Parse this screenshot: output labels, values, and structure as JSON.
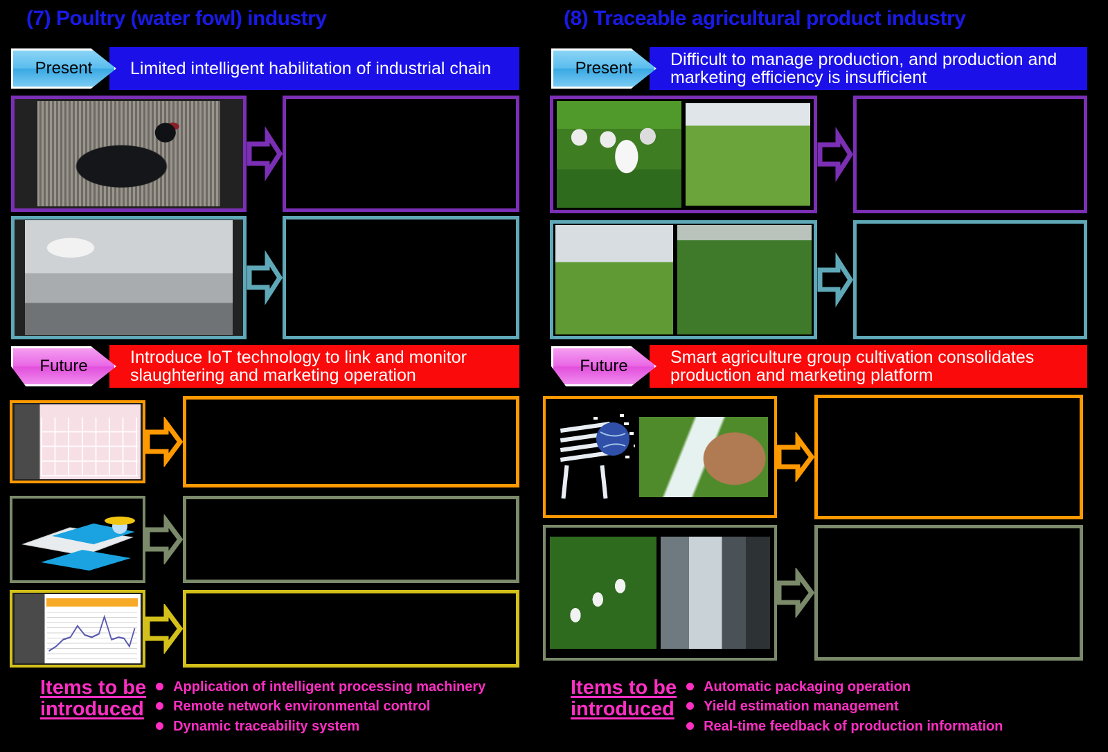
{
  "left": {
    "section_title": "(7) Poultry (water fowl) industry",
    "present": {
      "tag": "Present",
      "text": "Limited intelligent habilitation of industrial chain"
    },
    "future": {
      "tag": "Future",
      "text": "Introduce IoT technology to link and monitor slaughtering and marketing operation"
    },
    "present_rows": [
      {
        "image_name": "black-water-fowl-in-cage-photo",
        "border_color": "#7b2fb5",
        "text": ""
      },
      {
        "image_name": "poultry-slaughter-line-worker-photo",
        "border_color": "#5fa8b8",
        "text": ""
      }
    ],
    "future_rows": [
      {
        "image_name": "poultry-management-web-system-screenshot",
        "border_color": "#ff9900",
        "text": ""
      },
      {
        "image_name": "cloud-platform-farmer-illustration",
        "border_color": "#7b8a6a",
        "text": ""
      },
      {
        "image_name": "production-trend-chart-screenshot",
        "border_color": "#d4c01a",
        "text": ""
      }
    ],
    "items": {
      "label_line1": "Items to be",
      "label_line2": "introduced",
      "bullets": [
        "Application of intelligent processing machinery",
        "Remote network environmental control",
        "Dynamic traceability system"
      ]
    }
  },
  "right": {
    "section_title": "(8) Traceable agricultural product industry",
    "present": {
      "tag": "Present",
      "text": "Difficult to manage production, and production and marketing efficiency is insufficient"
    },
    "future": {
      "tag": "Future",
      "text": "Smart agriculture group cultivation consolidates production and marketing platform"
    },
    "present_rows": [
      {
        "image_name": "vegetable-farmers-group-photo",
        "image_name_2": "vegetable-field-rows-photo",
        "border_color": "#7b2fb5",
        "text": ""
      },
      {
        "image_name": "harvest-loading-truck-photo",
        "image_name_2": "field-harvesting-workers-photo",
        "border_color": "#5fa8b8",
        "text": ""
      }
    ],
    "future_rows": [
      {
        "image_name": "iot-cloud-globe-illustration",
        "image_name_2": "hand-holding-smartphone-in-field-photo",
        "border_color": "#ff9900",
        "text": ""
      },
      {
        "image_name": "dairy-cattle-grazing-photo",
        "image_name_2": "packing-facility-interior-photo",
        "border_color": "#7b8a6a",
        "text": ""
      }
    ],
    "items": {
      "label_line1": "Items to be",
      "label_line2": "introduced",
      "bullets": [
        "Automatic packaging operation",
        "Yield estimation management",
        "Real-time feedback of production information"
      ]
    }
  },
  "colors": {
    "title_blue": "#1a1ae6",
    "present_bar": "#1b11e8",
    "future_bar": "#fa0a0a",
    "present_tag": "#5bbdee",
    "future_tag": "#ea68e6",
    "items_pink": "#ff2fc4",
    "purple_border": "#7b2fb5",
    "teal_border": "#5fa8b8",
    "orange_border": "#ff9900",
    "olive_border": "#7b8a6a",
    "yellow_border": "#d4c01a",
    "background": "#000000"
  }
}
